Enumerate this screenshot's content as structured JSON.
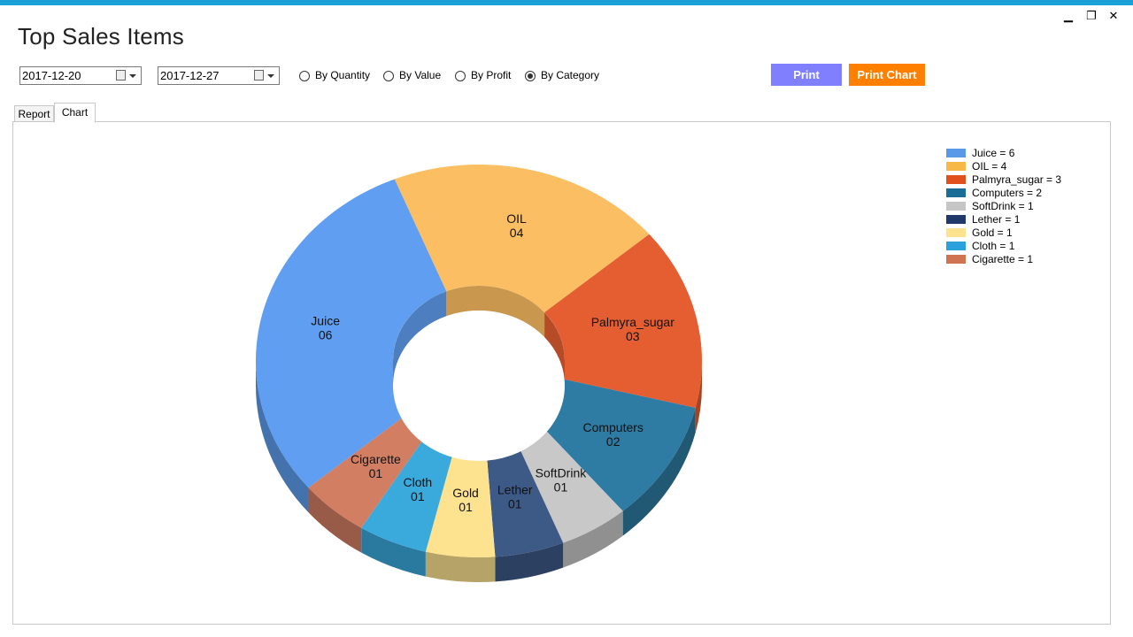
{
  "window": {
    "title": "Top Sales Items",
    "buttons": {
      "minimize": "▁",
      "restore": "❐",
      "close": "✕"
    }
  },
  "filters": {
    "from_date": "2017-12-20",
    "to_date": "2017-12-27",
    "radios": [
      {
        "label": "By Quantity",
        "selected": false
      },
      {
        "label": "By Value",
        "selected": false
      },
      {
        "label": "By Profit",
        "selected": false
      },
      {
        "label": "By Category",
        "selected": true
      }
    ]
  },
  "actions": {
    "print_label": "Print",
    "print_chart_label": "Print Chart",
    "print_color": "#8080ff",
    "print_chart_color": "#ff8000"
  },
  "tabs": [
    {
      "label": "Report",
      "active": false
    },
    {
      "label": "Chart",
      "active": true
    }
  ],
  "chart_data": {
    "type": "pie",
    "style": "3d-doughnut",
    "title": "",
    "slices": [
      {
        "name": "Juice",
        "value": 6,
        "label": "06",
        "color": "#5f9ef0"
      },
      {
        "name": "OIL",
        "value": 4,
        "label": "04",
        "color": "#fbbe62"
      },
      {
        "name": "Palmyra_sugar",
        "value": 3,
        "label": "03",
        "color": "#e45e31"
      },
      {
        "name": "Computers",
        "value": 2,
        "label": "02",
        "color": "#2e7ba3"
      },
      {
        "name": "SoftDrink",
        "value": 1,
        "label": "01",
        "color": "#c8c8c8"
      },
      {
        "name": "Lether",
        "value": 1,
        "label": "01",
        "color": "#3d5a87"
      },
      {
        "name": "Gold",
        "value": 1,
        "label": "01",
        "color": "#fde28f"
      },
      {
        "name": "Cloth",
        "value": 1,
        "label": "01",
        "color": "#3aaadd"
      },
      {
        "name": "Cigarette",
        "value": 1,
        "label": "01",
        "color": "#d27e63"
      }
    ],
    "legend": {
      "position": "top-right",
      "entries": [
        {
          "text": "Juice = 6",
          "color": "#5a98e8"
        },
        {
          "text": "OIL = 4",
          "color": "#f8b845"
        },
        {
          "text": "Palmyra_sugar = 3",
          "color": "#e2501f"
        },
        {
          "text": "Computers = 2",
          "color": "#1a6d96"
        },
        {
          "text": "SoftDrink = 1",
          "color": "#c6c6c6"
        },
        {
          "text": "Lether = 1",
          "color": "#1f3a6a"
        },
        {
          "text": "Gold = 1",
          "color": "#fde28f"
        },
        {
          "text": "Cloth = 1",
          "color": "#2aa0dc"
        },
        {
          "text": "Cigarette = 1",
          "color": "#cf7352"
        }
      ]
    }
  }
}
